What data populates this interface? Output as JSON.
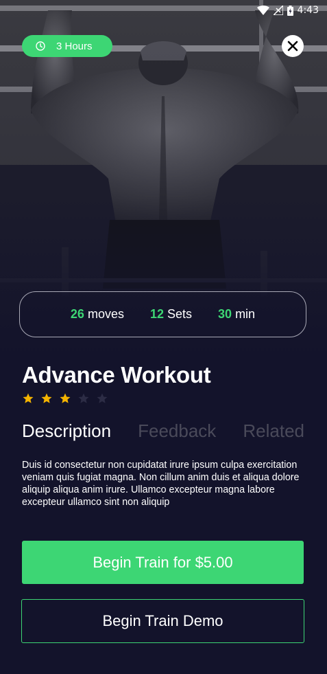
{
  "status_bar": {
    "time": "4:43"
  },
  "hero": {
    "image": "man-doing-pull-ups-photo"
  },
  "duration_badge": {
    "label": "3 Hours",
    "icon": "clock-icon"
  },
  "close_button": {
    "icon": "close-icon"
  },
  "stats": [
    {
      "value": "26",
      "unit": "moves"
    },
    {
      "value": "12",
      "unit": "Sets"
    },
    {
      "value": "30",
      "unit": "min"
    }
  ],
  "workout": {
    "title": "Advance Workout",
    "rating": 3,
    "rating_max": 5
  },
  "tabs": [
    {
      "label": "Description",
      "active": true
    },
    {
      "label": "Feedback",
      "active": false
    },
    {
      "label": "Related",
      "active": false
    }
  ],
  "description": "Duis id consectetur non cupidatat irure ipsum culpa exercitation veniam quis fugiat magna. Non cillum anim duis et aliqua dolore aliquip aliqua anim irure. Ullamco excepteur magna labore excepteur ullamco sint non aliquip",
  "buttons": {
    "buy_label": "Begin Train for $5.00",
    "demo_label": "Begin Train Demo"
  },
  "colors": {
    "accent": "#3dd674",
    "background": "#13132b",
    "star_filled": "#f4b400",
    "star_empty": "#2c2c45",
    "tab_inactive": "#4a4a5a"
  }
}
